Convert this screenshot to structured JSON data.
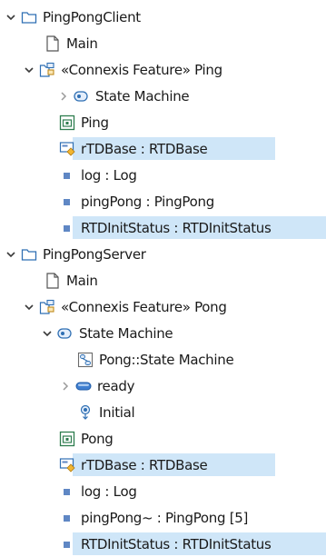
{
  "tree": {
    "client": {
      "label": "PingPongClient",
      "main": "Main",
      "feature": {
        "label": "«Connexis Feature» Ping",
        "state_machine": "State Machine",
        "ping": "Ping",
        "rtdbase": "rTDBase : RTDBase",
        "log": "log : Log",
        "pingpong": "pingPong : PingPong",
        "initstatus": "RTDInitStatus : RTDInitStatus"
      }
    },
    "server": {
      "label": "PingPongServer",
      "main": "Main",
      "feature": {
        "label": "«Connexis Feature» Pong",
        "state_machine": {
          "label": "State Machine",
          "diagram": "Pong::State Machine",
          "ready": "ready",
          "initial": "Initial"
        },
        "pong": "Pong",
        "rtdbase": "rTDBase : RTDBase",
        "log": "log : Log",
        "pingpong": "pingPong~ : PingPong [5]",
        "initstatus": "RTDInitStatus : RTDInitStatus"
      }
    }
  },
  "colors": {
    "selection": "#cfe6f8",
    "folder": "#2f6fb3",
    "attribute": "#5f87c4",
    "capsule": "#2e8b57"
  }
}
